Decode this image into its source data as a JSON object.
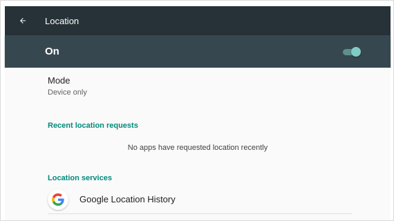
{
  "toolbar": {
    "back_icon": "arrow-back-icon",
    "title": "Location",
    "background": "#263238"
  },
  "master_switch": {
    "label": "On",
    "state": "on",
    "accent": "#80cbc4",
    "background": "#37474f"
  },
  "mode": {
    "title": "Mode",
    "summary": "Device only"
  },
  "recent_requests": {
    "header": "Recent location requests",
    "empty_message": "No apps have requested location recently"
  },
  "services": {
    "header": "Location services",
    "items": [
      {
        "icon": "google-g-icon",
        "label": "Google Location History"
      }
    ]
  },
  "colors": {
    "category_text": "#00897b"
  }
}
